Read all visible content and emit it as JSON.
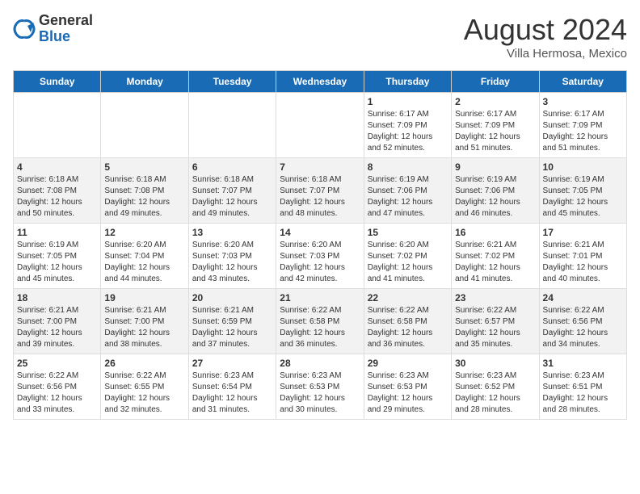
{
  "header": {
    "logo_general": "General",
    "logo_blue": "Blue",
    "month_year": "August 2024",
    "location": "Villa Hermosa, Mexico"
  },
  "days_of_week": [
    "Sunday",
    "Monday",
    "Tuesday",
    "Wednesday",
    "Thursday",
    "Friday",
    "Saturday"
  ],
  "weeks": [
    [
      {
        "day": "",
        "info": ""
      },
      {
        "day": "",
        "info": ""
      },
      {
        "day": "",
        "info": ""
      },
      {
        "day": "",
        "info": ""
      },
      {
        "day": "1",
        "info": "Sunrise: 6:17 AM\nSunset: 7:09 PM\nDaylight: 12 hours\nand 52 minutes."
      },
      {
        "day": "2",
        "info": "Sunrise: 6:17 AM\nSunset: 7:09 PM\nDaylight: 12 hours\nand 51 minutes."
      },
      {
        "day": "3",
        "info": "Sunrise: 6:17 AM\nSunset: 7:09 PM\nDaylight: 12 hours\nand 51 minutes."
      }
    ],
    [
      {
        "day": "4",
        "info": "Sunrise: 6:18 AM\nSunset: 7:08 PM\nDaylight: 12 hours\nand 50 minutes."
      },
      {
        "day": "5",
        "info": "Sunrise: 6:18 AM\nSunset: 7:08 PM\nDaylight: 12 hours\nand 49 minutes."
      },
      {
        "day": "6",
        "info": "Sunrise: 6:18 AM\nSunset: 7:07 PM\nDaylight: 12 hours\nand 49 minutes."
      },
      {
        "day": "7",
        "info": "Sunrise: 6:18 AM\nSunset: 7:07 PM\nDaylight: 12 hours\nand 48 minutes."
      },
      {
        "day": "8",
        "info": "Sunrise: 6:19 AM\nSunset: 7:06 PM\nDaylight: 12 hours\nand 47 minutes."
      },
      {
        "day": "9",
        "info": "Sunrise: 6:19 AM\nSunset: 7:06 PM\nDaylight: 12 hours\nand 46 minutes."
      },
      {
        "day": "10",
        "info": "Sunrise: 6:19 AM\nSunset: 7:05 PM\nDaylight: 12 hours\nand 45 minutes."
      }
    ],
    [
      {
        "day": "11",
        "info": "Sunrise: 6:19 AM\nSunset: 7:05 PM\nDaylight: 12 hours\nand 45 minutes."
      },
      {
        "day": "12",
        "info": "Sunrise: 6:20 AM\nSunset: 7:04 PM\nDaylight: 12 hours\nand 44 minutes."
      },
      {
        "day": "13",
        "info": "Sunrise: 6:20 AM\nSunset: 7:03 PM\nDaylight: 12 hours\nand 43 minutes."
      },
      {
        "day": "14",
        "info": "Sunrise: 6:20 AM\nSunset: 7:03 PM\nDaylight: 12 hours\nand 42 minutes."
      },
      {
        "day": "15",
        "info": "Sunrise: 6:20 AM\nSunset: 7:02 PM\nDaylight: 12 hours\nand 41 minutes."
      },
      {
        "day": "16",
        "info": "Sunrise: 6:21 AM\nSunset: 7:02 PM\nDaylight: 12 hours\nand 41 minutes."
      },
      {
        "day": "17",
        "info": "Sunrise: 6:21 AM\nSunset: 7:01 PM\nDaylight: 12 hours\nand 40 minutes."
      }
    ],
    [
      {
        "day": "18",
        "info": "Sunrise: 6:21 AM\nSunset: 7:00 PM\nDaylight: 12 hours\nand 39 minutes."
      },
      {
        "day": "19",
        "info": "Sunrise: 6:21 AM\nSunset: 7:00 PM\nDaylight: 12 hours\nand 38 minutes."
      },
      {
        "day": "20",
        "info": "Sunrise: 6:21 AM\nSunset: 6:59 PM\nDaylight: 12 hours\nand 37 minutes."
      },
      {
        "day": "21",
        "info": "Sunrise: 6:22 AM\nSunset: 6:58 PM\nDaylight: 12 hours\nand 36 minutes."
      },
      {
        "day": "22",
        "info": "Sunrise: 6:22 AM\nSunset: 6:58 PM\nDaylight: 12 hours\nand 36 minutes."
      },
      {
        "day": "23",
        "info": "Sunrise: 6:22 AM\nSunset: 6:57 PM\nDaylight: 12 hours\nand 35 minutes."
      },
      {
        "day": "24",
        "info": "Sunrise: 6:22 AM\nSunset: 6:56 PM\nDaylight: 12 hours\nand 34 minutes."
      }
    ],
    [
      {
        "day": "25",
        "info": "Sunrise: 6:22 AM\nSunset: 6:56 PM\nDaylight: 12 hours\nand 33 minutes."
      },
      {
        "day": "26",
        "info": "Sunrise: 6:22 AM\nSunset: 6:55 PM\nDaylight: 12 hours\nand 32 minutes."
      },
      {
        "day": "27",
        "info": "Sunrise: 6:23 AM\nSunset: 6:54 PM\nDaylight: 12 hours\nand 31 minutes."
      },
      {
        "day": "28",
        "info": "Sunrise: 6:23 AM\nSunset: 6:53 PM\nDaylight: 12 hours\nand 30 minutes."
      },
      {
        "day": "29",
        "info": "Sunrise: 6:23 AM\nSunset: 6:53 PM\nDaylight: 12 hours\nand 29 minutes."
      },
      {
        "day": "30",
        "info": "Sunrise: 6:23 AM\nSunset: 6:52 PM\nDaylight: 12 hours\nand 28 minutes."
      },
      {
        "day": "31",
        "info": "Sunrise: 6:23 AM\nSunset: 6:51 PM\nDaylight: 12 hours\nand 28 minutes."
      }
    ]
  ]
}
